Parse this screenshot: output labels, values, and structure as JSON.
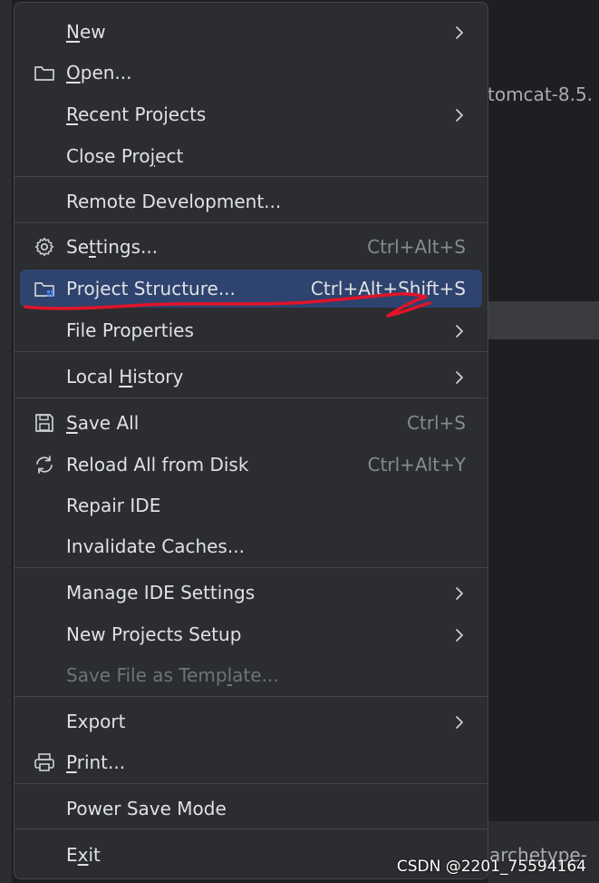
{
  "background": {
    "text_top": "tomcat-8.5.",
    "text_bottom": "archetype-"
  },
  "menu": {
    "items": [
      {
        "label": "New",
        "mnemonic_index": 0,
        "chevron": true
      },
      {
        "label": "Open...",
        "mnemonic_index": 0,
        "icon": "folder-icon"
      },
      {
        "label": "Recent Projects",
        "mnemonic_index": 0,
        "chevron": true
      },
      {
        "label": "Close Project",
        "mnemonic_index": 9
      },
      {
        "label": "Remote Development..."
      },
      {
        "label": "Settings...",
        "mnemonic_index": 2,
        "icon": "gear-icon",
        "shortcut": "Ctrl+Alt+S"
      },
      {
        "label": "Project Structure...",
        "icon": "project-structure-icon",
        "shortcut": "Ctrl+Alt+Shift+S",
        "selected": true
      },
      {
        "label": "File Properties",
        "chevron": true
      },
      {
        "label": "Local History",
        "mnemonic_index": 6,
        "chevron": true
      },
      {
        "label": "Save All",
        "mnemonic_index": 0,
        "icon": "save-icon",
        "shortcut": "Ctrl+S"
      },
      {
        "label": "Reload All from Disk",
        "icon": "reload-icon",
        "shortcut": "Ctrl+Alt+Y"
      },
      {
        "label": "Repair IDE"
      },
      {
        "label": "Invalidate Caches..."
      },
      {
        "label": "Manage IDE Settings",
        "chevron": true
      },
      {
        "label": "New Projects Setup",
        "chevron": true
      },
      {
        "label": "Save File as Template...",
        "mnemonic_index": 17,
        "disabled": true
      },
      {
        "label": "Export",
        "chevron": true
      },
      {
        "label": "Print...",
        "mnemonic_index": 0,
        "icon": "printer-icon"
      },
      {
        "label": "Power Save Mode"
      },
      {
        "label": "Exit",
        "mnemonic_index": 1
      }
    ]
  },
  "colors": {
    "selection": "#2e436e",
    "annotation": "#e0142a"
  },
  "watermark": "CSDN @2201_75594164"
}
